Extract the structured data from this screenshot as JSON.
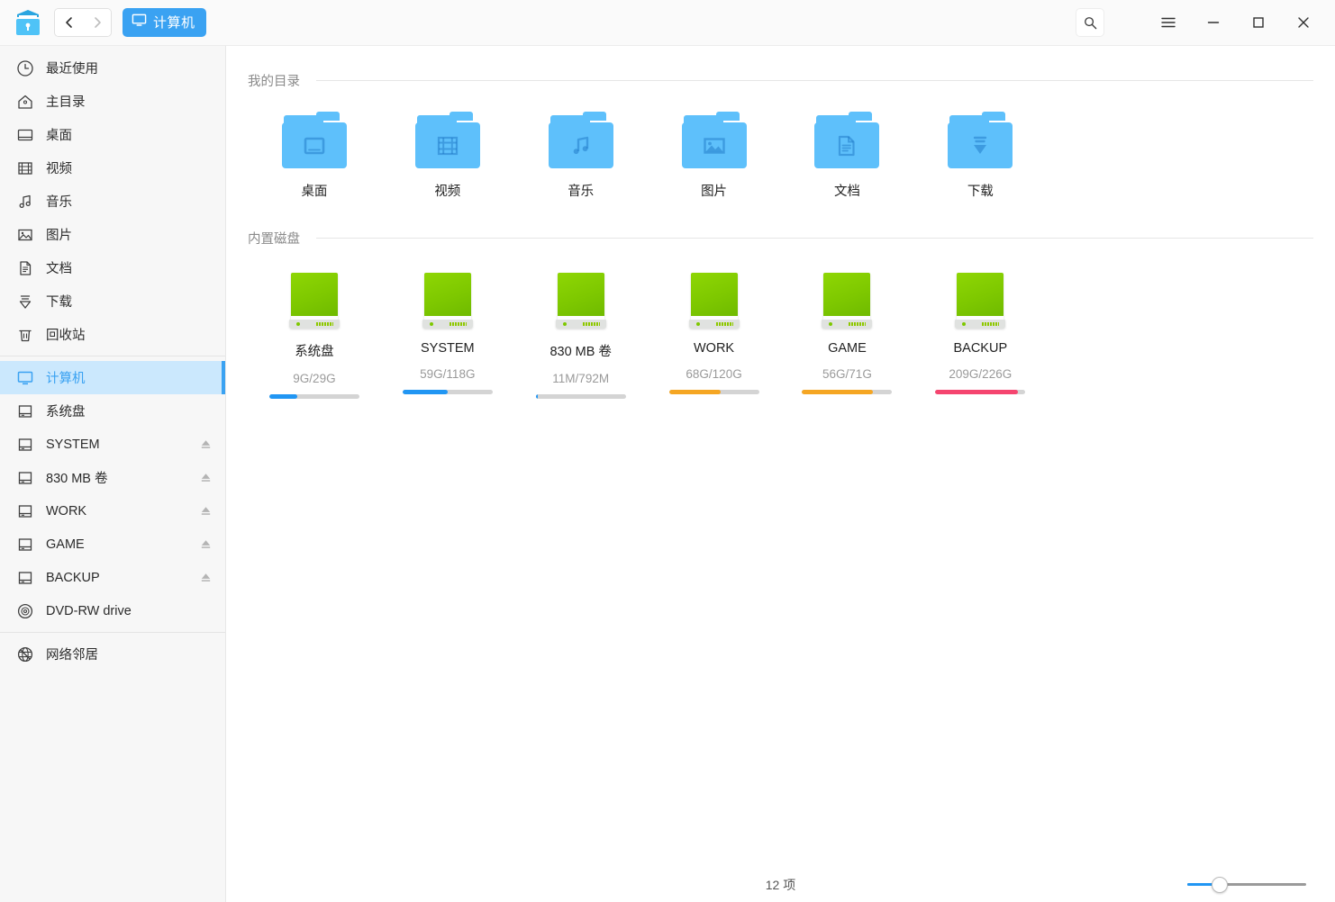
{
  "window": {
    "app_icon_name": "file-manager-icon",
    "nav_back": "‹",
    "nav_forward": "›",
    "breadcrumb": "计算机",
    "search_icon": "search-icon",
    "menu_icon": "hamburger-menu-icon",
    "minimize_icon": "minimize-icon",
    "maximize_icon": "maximize-icon",
    "close_icon": "close-icon"
  },
  "colors": {
    "accent": "#3aa2f2",
    "selected_bg": "#cbe8fd",
    "folder": "#5ec0fb",
    "disk_green": "#7ec800",
    "meter_blue": "#2196f3",
    "meter_orange": "#f5a623",
    "meter_pink": "#f5456f",
    "meter_track": "#d4d4d4"
  },
  "sidebar": {
    "groups": [
      {
        "items": [
          {
            "label": "最近使用",
            "icon": "clock-icon",
            "selected": false,
            "eject": false
          },
          {
            "label": "主目录",
            "icon": "home-icon",
            "selected": false,
            "eject": false
          },
          {
            "label": "桌面",
            "icon": "desktop-icon",
            "selected": false,
            "eject": false
          },
          {
            "label": "视频",
            "icon": "video-icon",
            "selected": false,
            "eject": false
          },
          {
            "label": "音乐",
            "icon": "music-icon",
            "selected": false,
            "eject": false
          },
          {
            "label": "图片",
            "icon": "picture-icon",
            "selected": false,
            "eject": false
          },
          {
            "label": "文档",
            "icon": "document-icon",
            "selected": false,
            "eject": false
          },
          {
            "label": "下载",
            "icon": "download-icon",
            "selected": false,
            "eject": false
          },
          {
            "label": "回收站",
            "icon": "trash-icon",
            "selected": false,
            "eject": false
          }
        ]
      },
      {
        "items": [
          {
            "label": "计算机",
            "icon": "computer-icon",
            "selected": true,
            "eject": false
          },
          {
            "label": "系统盘",
            "icon": "drive-icon",
            "selected": false,
            "eject": false
          },
          {
            "label": "SYSTEM",
            "icon": "drive-icon",
            "selected": false,
            "eject": true
          },
          {
            "label": "830 MB 卷",
            "icon": "drive-icon",
            "selected": false,
            "eject": true
          },
          {
            "label": "WORK",
            "icon": "drive-icon",
            "selected": false,
            "eject": true
          },
          {
            "label": "GAME",
            "icon": "drive-icon",
            "selected": false,
            "eject": true
          },
          {
            "label": "BACKUP",
            "icon": "drive-icon",
            "selected": false,
            "eject": true
          },
          {
            "label": "DVD-RW drive",
            "icon": "disc-icon",
            "selected": false,
            "eject": false
          }
        ]
      },
      {
        "items": [
          {
            "label": "网络邻居",
            "icon": "network-icon",
            "selected": false,
            "eject": false
          }
        ]
      }
    ]
  },
  "main": {
    "sections": [
      {
        "title": "我的目录",
        "kind": "folders",
        "items": [
          {
            "label": "桌面",
            "icon": "folder-desktop-icon"
          },
          {
            "label": "视频",
            "icon": "folder-video-icon"
          },
          {
            "label": "音乐",
            "icon": "folder-music-icon"
          },
          {
            "label": "图片",
            "icon": "folder-picture-icon"
          },
          {
            "label": "文档",
            "icon": "folder-document-icon"
          },
          {
            "label": "下载",
            "icon": "folder-download-icon"
          }
        ]
      },
      {
        "title": "内置磁盘",
        "kind": "disks",
        "items": [
          {
            "label": "系统盘",
            "usage": "9G/29G",
            "percent": 31,
            "bar_color": "#2196f3"
          },
          {
            "label": "SYSTEM",
            "usage": "59G/118G",
            "percent": 50,
            "bar_color": "#2196f3"
          },
          {
            "label": "830 MB 卷",
            "usage": "11M/792M",
            "percent": 2,
            "bar_color": "#2196f3"
          },
          {
            "label": "WORK",
            "usage": "68G/120G",
            "percent": 57,
            "bar_color": "#f5a623"
          },
          {
            "label": "GAME",
            "usage": "56G/71G",
            "percent": 79,
            "bar_color": "#f5a623"
          },
          {
            "label": "BACKUP",
            "usage": "209G/226G",
            "percent": 92,
            "bar_color": "#f5456f"
          }
        ]
      }
    ]
  },
  "statusbar": {
    "count_text": "12 项",
    "zoom_percent": 27
  }
}
